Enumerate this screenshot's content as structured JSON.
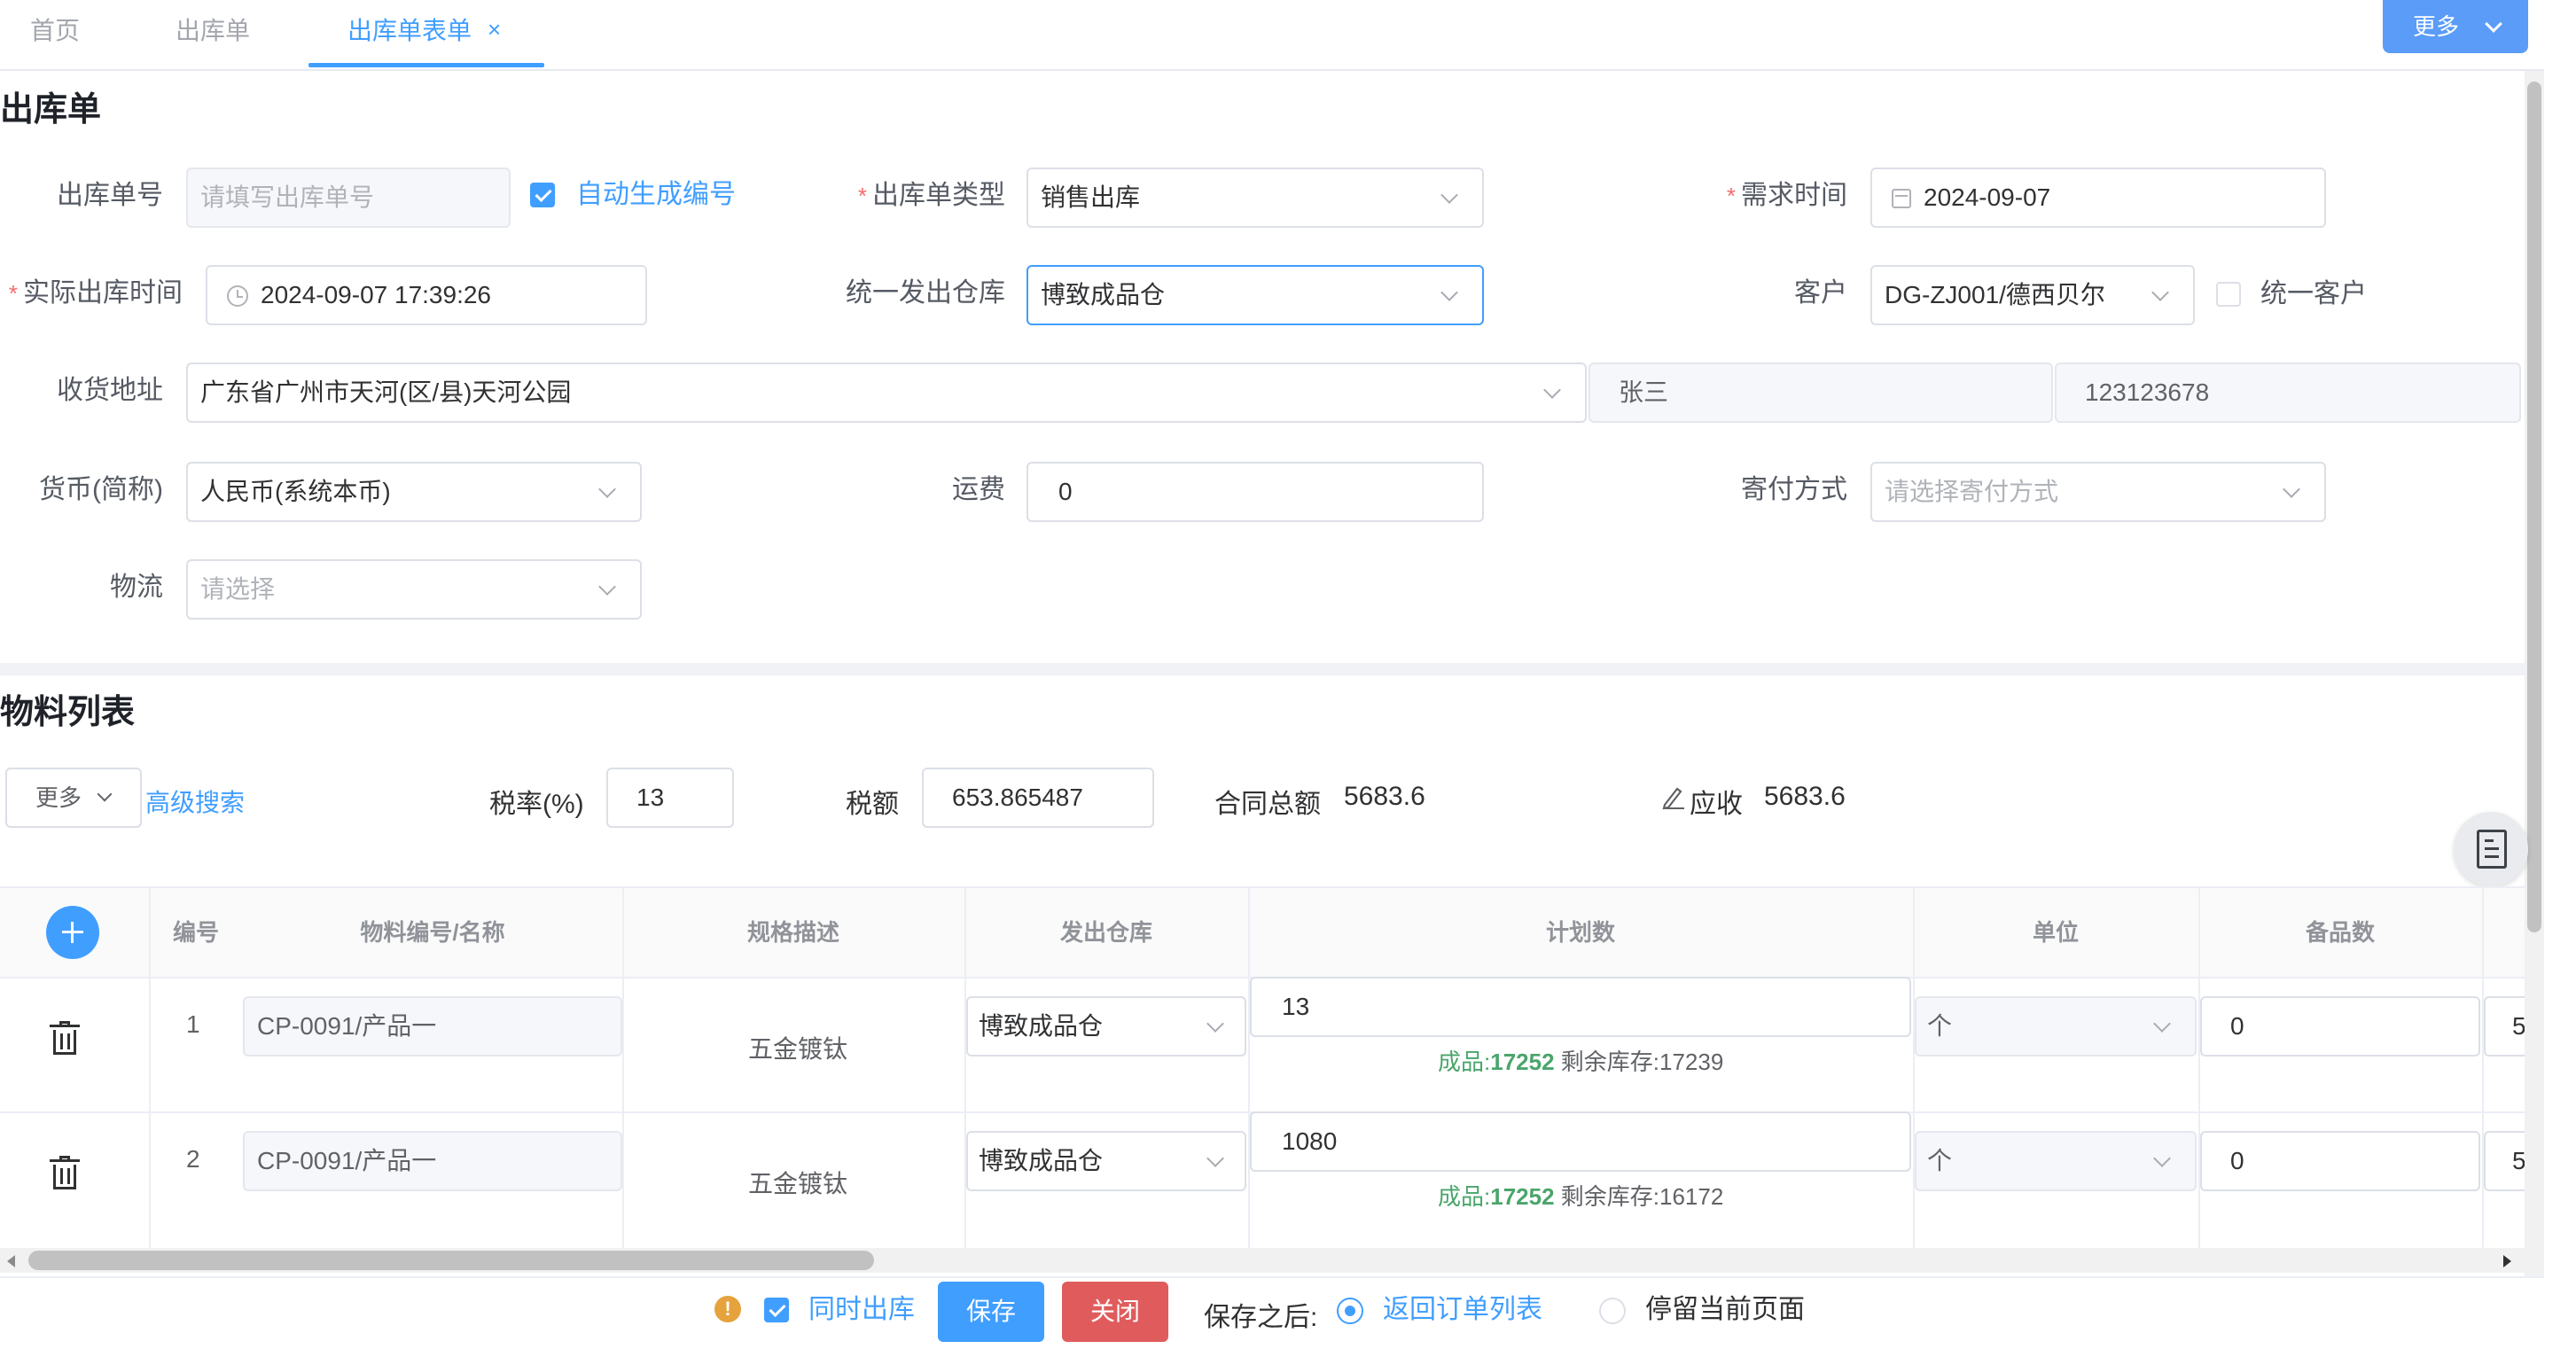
{
  "tabs": [
    {
      "label": "首页",
      "active": false
    },
    {
      "label": "出库单",
      "active": false
    },
    {
      "label": "出库单表单",
      "active": true,
      "close": "×"
    }
  ],
  "more_button": "更多",
  "form": {
    "title": "出库单",
    "order_no": {
      "label": "出库单号",
      "placeholder": "请填写出库单号"
    },
    "auto_number": {
      "label": "自动生成编号",
      "checked": true
    },
    "order_type": {
      "label": "出库单类型",
      "required": "*",
      "value": "销售出库"
    },
    "demand_time": {
      "label": "需求时间",
      "required": "*",
      "value": "2024-09-07"
    },
    "actual_time": {
      "label": "实际出库时间",
      "required": "*",
      "value": "2024-09-07 17:39:26"
    },
    "warehouse": {
      "label": "统一发出仓库",
      "value": "博致成品仓"
    },
    "customer": {
      "label": "客户",
      "value": "DG-ZJ001/德西贝尔"
    },
    "unified_customer": {
      "label": "统一客户",
      "checked": false
    },
    "address": {
      "label": "收货地址",
      "value": "广东省广州市天河(区/县)天河公园",
      "contact": "张三",
      "phone": "123123678"
    },
    "currency": {
      "label": "货币(简称)",
      "value": "人民币(系统本币)"
    },
    "freight": {
      "label": "运费",
      "value": "0"
    },
    "shipping_method": {
      "label": "寄付方式",
      "placeholder": "请选择寄付方式"
    },
    "logistics": {
      "label": "物流",
      "placeholder": "请选择"
    }
  },
  "materials": {
    "title": "物料列表",
    "more": "更多",
    "advanced_search": "高级搜索",
    "tax_rate": {
      "label": "税率(%)",
      "value": "13"
    },
    "tax_amount": {
      "label": "税额",
      "value": "653.865487"
    },
    "contract_total": {
      "label": "合同总额",
      "value": "5683.6"
    },
    "receivable": {
      "label": "应收",
      "value": "5683.6"
    },
    "columns": [
      "编号",
      "物料编号/名称",
      "规格描述",
      "发出仓库",
      "计划数",
      "单位",
      "备品数"
    ],
    "rows": [
      {
        "no": "1",
        "material": "CP-0091/产品一",
        "spec": "五金镀钛",
        "warehouse": "博致成品仓",
        "plan": "13",
        "stock_label": "成品:",
        "stock_value": "17252",
        "remain": "剩余库存:17239",
        "unit": "个",
        "spare": "0",
        "extra": "5"
      },
      {
        "no": "2",
        "material": "CP-0091/产品一",
        "spec": "五金镀钛",
        "warehouse": "博致成品仓",
        "plan": "1080",
        "stock_label": "成品:",
        "stock_value": "17252",
        "remain": "剩余库存:16172",
        "unit": "个",
        "spare": "0",
        "extra": "5"
      }
    ]
  },
  "footer": {
    "warn": "!",
    "ship_together": {
      "label": "同时出库",
      "checked": true
    },
    "save": "保存",
    "close": "关闭",
    "after_save": "保存之后:",
    "options": [
      {
        "label": "返回订单列表",
        "selected": true
      },
      {
        "label": "停留当前页面",
        "selected": false
      }
    ]
  }
}
